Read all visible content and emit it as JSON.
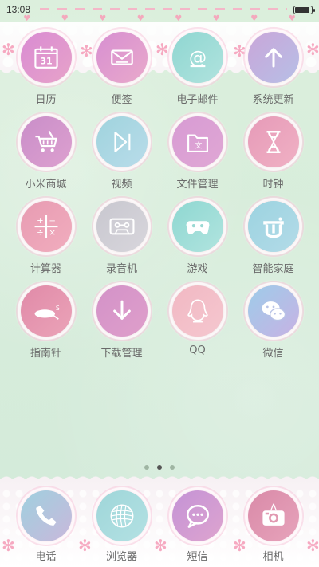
{
  "status_bar": {
    "time": "13:08"
  },
  "apps": [
    {
      "label": "日历",
      "icon": "calendar-icon",
      "bg": [
        "#d98bd3",
        "#e7a3c9"
      ],
      "glyph": "31"
    },
    {
      "label": "便签",
      "icon": "envelope-icon",
      "bg": [
        "#d78fd1",
        "#e9a9cb"
      ]
    },
    {
      "label": "电子邮件",
      "icon": "at-sign-icon",
      "bg": [
        "#8fd6d1",
        "#b0e3de"
      ],
      "glyph": "@"
    },
    {
      "label": "系统更新",
      "icon": "arrow-up-icon",
      "bg": [
        "#c9a6d9",
        "#b7bfe6"
      ]
    },
    {
      "label": "小米商城",
      "icon": "shopping-cart-icon",
      "bg": [
        "#c98ec9",
        "#dda0cf"
      ]
    },
    {
      "label": "视频",
      "icon": "play-icon",
      "bg": [
        "#9fd3dd",
        "#b9dcea"
      ]
    },
    {
      "label": "文件管理",
      "icon": "folder-icon",
      "bg": [
        "#d79bd3",
        "#e0a7d5"
      ],
      "glyph": "文"
    },
    {
      "label": "时钟",
      "icon": "hourglass-icon",
      "bg": [
        "#e69ab8",
        "#f0b1c4"
      ]
    },
    {
      "label": "计算器",
      "icon": "calculator-icon",
      "bg": [
        "#e79bb2",
        "#f1adbe"
      ]
    },
    {
      "label": "录音机",
      "icon": "cassette-icon",
      "bg": [
        "#c8c7cf",
        "#d8d6dc"
      ]
    },
    {
      "label": "游戏",
      "icon": "gamepad-icon",
      "bg": [
        "#8ed7d1",
        "#b1e4df"
      ]
    },
    {
      "label": "智能家庭",
      "icon": "smart-home-icon",
      "bg": [
        "#9cd3e0",
        "#b3dbe8"
      ]
    },
    {
      "label": "指南针",
      "icon": "compass-icon",
      "bg": [
        "#e08aa8",
        "#eba3b8"
      ]
    },
    {
      "label": "下载管理",
      "icon": "download-icon",
      "bg": [
        "#d392c8",
        "#df9fcb"
      ]
    },
    {
      "label": "QQ",
      "icon": "penguin-icon",
      "bg": [
        "#f1b8c3",
        "#f5c7cf"
      ]
    },
    {
      "label": "微信",
      "icon": "chat-bubbles-icon",
      "bg": [
        "#9ecce9",
        "#c7b2e4"
      ]
    }
  ],
  "page_indicator": {
    "count": 3,
    "active": 1
  },
  "dock": [
    {
      "label": "电话",
      "icon": "phone-icon",
      "bg": [
        "#9fd0de",
        "#c9b8dc"
      ]
    },
    {
      "label": "浏览器",
      "icon": "globe-icon",
      "bg": [
        "#9fd6d9",
        "#b3e1e3"
      ]
    },
    {
      "label": "短信",
      "icon": "message-icon",
      "bg": [
        "#c493d6",
        "#dea4cf"
      ]
    },
    {
      "label": "相机",
      "icon": "camera-icon",
      "bg": [
        "#d98aa8",
        "#e7a3bb"
      ]
    }
  ]
}
